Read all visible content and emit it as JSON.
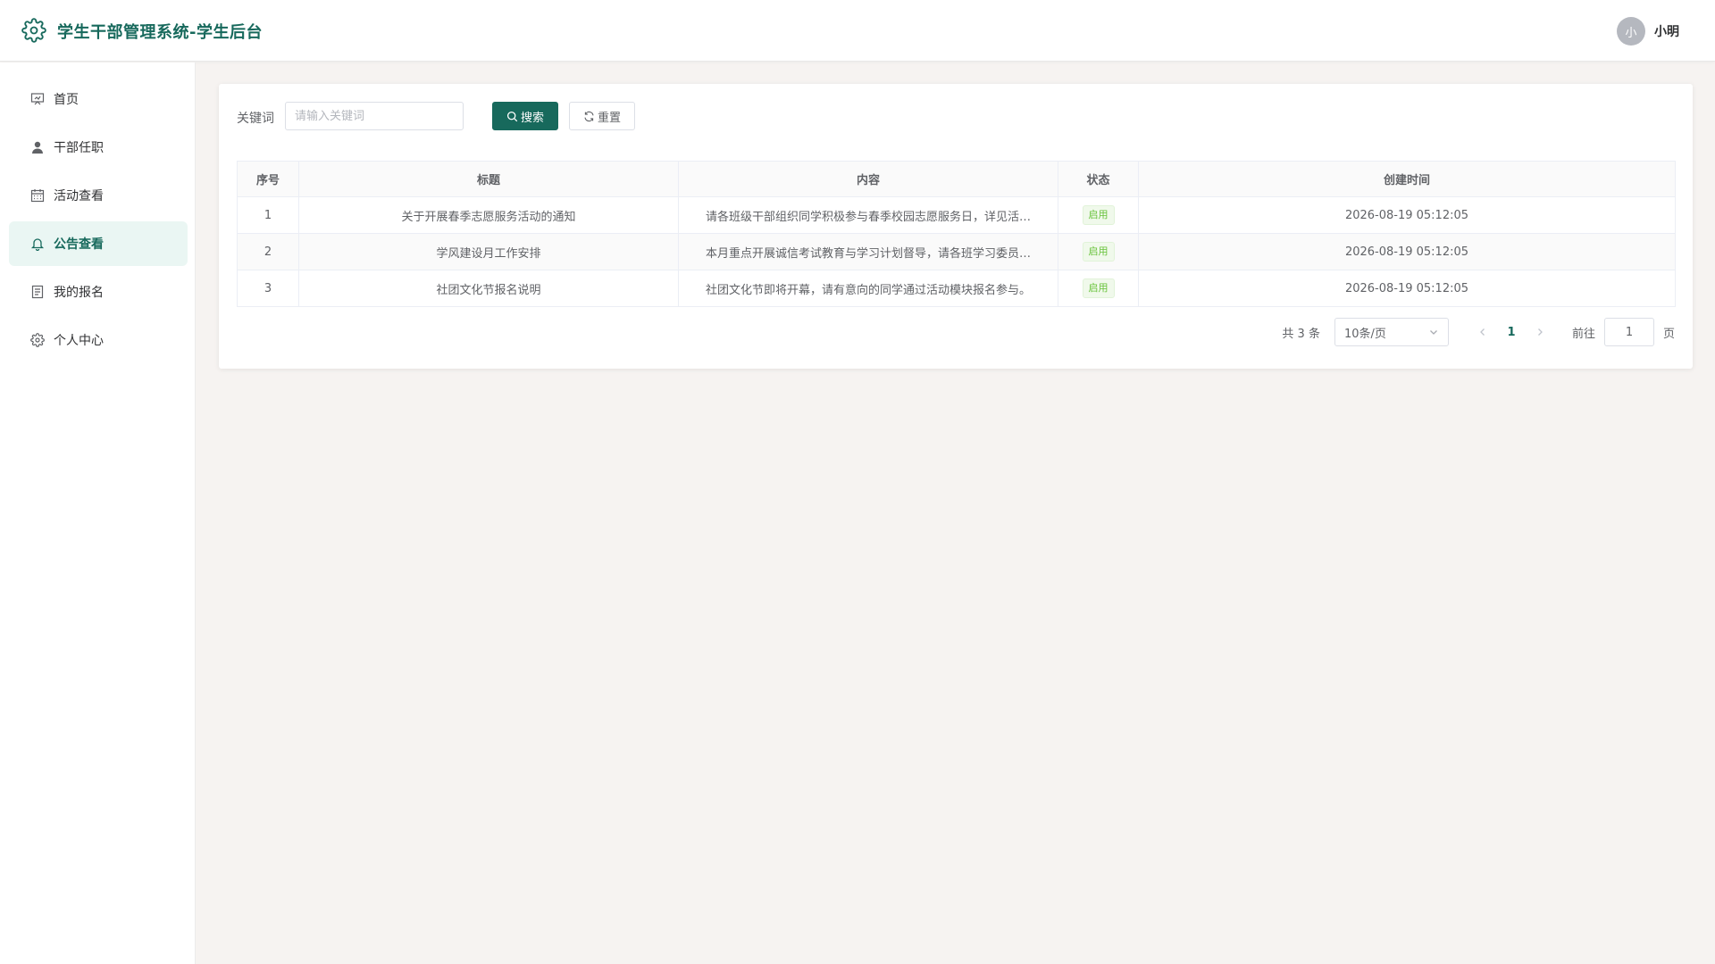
{
  "header": {
    "title": "学生干部管理系统-学生后台",
    "avatar_text": "小",
    "username": "小明",
    "brand_color": "#17695c"
  },
  "sidebar": {
    "items": [
      {
        "label": "首页",
        "icon": "presentation-icon",
        "active": false
      },
      {
        "label": "干部任职",
        "icon": "user-icon",
        "active": false
      },
      {
        "label": "活动查看",
        "icon": "calendar-icon",
        "active": false
      },
      {
        "label": "公告查看",
        "icon": "bell-icon",
        "active": true
      },
      {
        "label": "我的报名",
        "icon": "document-icon",
        "active": false
      },
      {
        "label": "个人中心",
        "icon": "gear-icon",
        "active": false
      }
    ]
  },
  "search": {
    "label": "关键词",
    "placeholder": "请输入关键词",
    "value": "",
    "search_button": "搜索",
    "reset_button": "重置"
  },
  "table": {
    "columns": [
      "序号",
      "标题",
      "内容",
      "状态",
      "创建时间"
    ],
    "rows": [
      {
        "index": "1",
        "title": "关于开展春季志愿服务活动的通知",
        "content": "请各班级干部组织同学积极参与春季校园志愿服务日，详见活…",
        "status": "启用",
        "created": "2026-08-19 05:12:05"
      },
      {
        "index": "2",
        "title": "学风建设月工作安排",
        "content": "本月重点开展诚信考试教育与学习计划督导，请各班学习委员…",
        "status": "启用",
        "created": "2026-08-19 05:12:05"
      },
      {
        "index": "3",
        "title": "社团文化节报名说明",
        "content": "社团文化节即将开幕，请有意向的同学通过活动模块报名参与。",
        "status": "启用",
        "created": "2026-08-19 05:12:05"
      }
    ]
  },
  "pagination": {
    "total_text": "共 3 条",
    "page_size": "10条/页",
    "current_page": "1",
    "goto_label": "前往",
    "goto_value": "1",
    "page_suffix": "页"
  }
}
